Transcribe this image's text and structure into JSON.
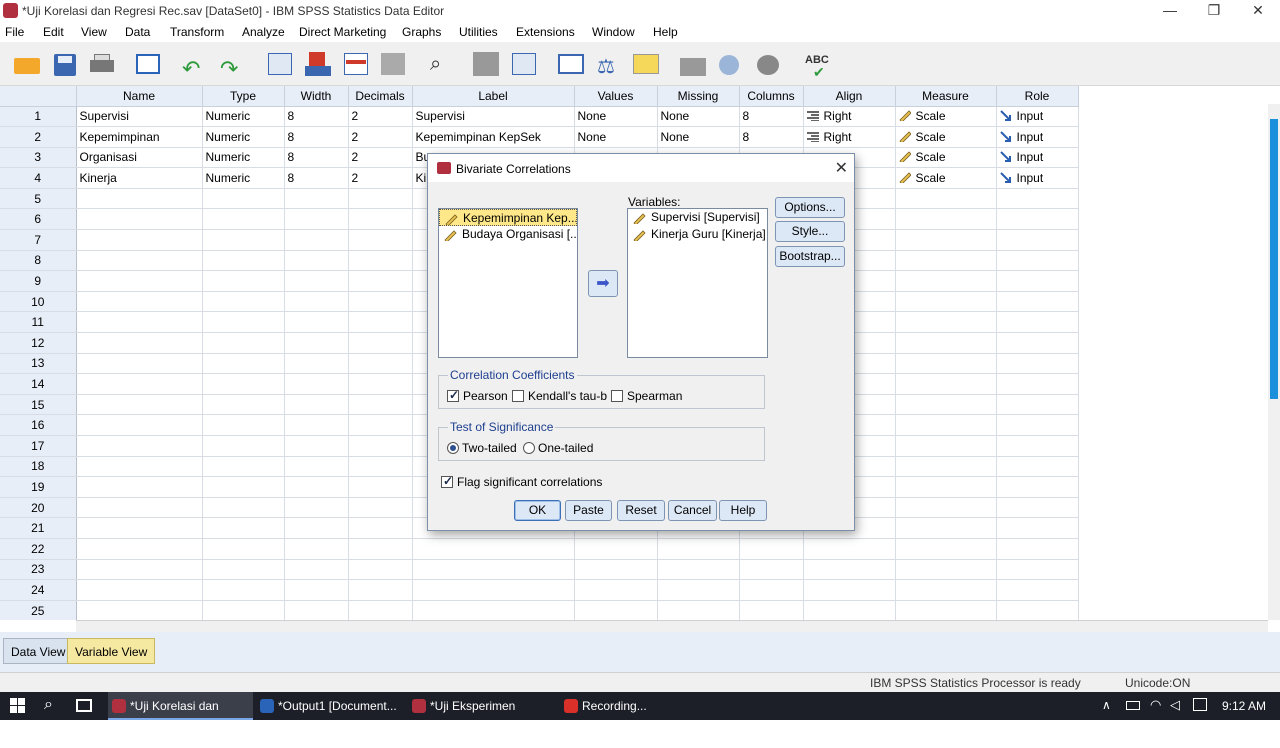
{
  "window": {
    "title": "*Uji Korelasi dan Regresi Rec.sav [DataSet0] - IBM SPSS Statistics Data Editor"
  },
  "menu": [
    "File",
    "Edit",
    "View",
    "Data",
    "Transform",
    "Analyze",
    "Direct Marketing",
    "Graphs",
    "Utilities",
    "Extensions",
    "Window",
    "Help"
  ],
  "toolbar_icons": [
    "open-folder-icon",
    "save-icon",
    "print-icon",
    "dialog-recall-icon",
    "undo-icon",
    "redo-icon",
    "goto-case-icon",
    "goto-variable-icon",
    "variables-icon",
    "run-descriptives-icon",
    "find-icon",
    "insert-cases-icon",
    "insert-variable-icon",
    "split-file-icon",
    "weight-cases-icon",
    "select-cases-icon",
    "value-labels-icon",
    "use-sets-icon",
    "show-all-variables-icon",
    "spell-check-icon"
  ],
  "grid": {
    "columns": [
      "Name",
      "Type",
      "Width",
      "Decimals",
      "Label",
      "Values",
      "Missing",
      "Columns",
      "Align",
      "Measure",
      "Role"
    ],
    "rows": [
      {
        "n": "1",
        "name": "Supervisi",
        "type": "Numeric",
        "width": "8",
        "decimals": "2",
        "label": "Supervisi",
        "values": "None",
        "missing": "None",
        "columns": "8",
        "align": "Right",
        "measure": "Scale",
        "role": "Input"
      },
      {
        "n": "2",
        "name": "Kepemimpinan",
        "type": "Numeric",
        "width": "8",
        "decimals": "2",
        "label": "Kepemimpinan KepSek",
        "values": "None",
        "missing": "None",
        "columns": "8",
        "align": "Right",
        "measure": "Scale",
        "role": "Input"
      },
      {
        "n": "3",
        "name": "Organisasi",
        "type": "Numeric",
        "width": "8",
        "decimals": "2",
        "label": "Bu",
        "values": "",
        "missing": "",
        "columns": "",
        "align": "",
        "measure": "Scale",
        "role": "Input"
      },
      {
        "n": "4",
        "name": "Kinerja",
        "type": "Numeric",
        "width": "8",
        "decimals": "2",
        "label": "Ki",
        "values": "",
        "missing": "",
        "columns": "",
        "align": "",
        "measure": "Scale",
        "role": "Input"
      }
    ],
    "empty_rows": [
      "5",
      "6",
      "7",
      "8",
      "9",
      "10",
      "11",
      "12",
      "13",
      "14",
      "15",
      "16",
      "17",
      "18",
      "19",
      "20",
      "21",
      "22",
      "23",
      "24",
      "25"
    ]
  },
  "tabs": {
    "data_view": "Data View",
    "variable_view": "Variable View"
  },
  "status": {
    "processor": "IBM SPSS Statistics Processor is ready",
    "unicode": "Unicode:ON"
  },
  "taskbar": {
    "items": [
      "*Uji Korelasi dan Regr...",
      "*Output1 [Document...",
      "*Uji Eksperimen Rec.s...",
      "Recording..."
    ],
    "clock": "9:12 AM"
  },
  "dialog": {
    "title": "Bivariate Correlations",
    "source_items": [
      "Kepemimpinan Kep...",
      "Budaya Organisasi [..."
    ],
    "variables_label": "Variables:",
    "target_items": [
      "Supervisi [Supervisi]",
      "Kinerja Guru [Kinerja]"
    ],
    "side_buttons": [
      "Options...",
      "Style...",
      "Bootstrap..."
    ],
    "coefficients": {
      "legend": "Correlation Coefficients",
      "pearson": "Pearson",
      "pearson_checked": true,
      "kendall": "Kendall's tau-b",
      "kendall_checked": false,
      "spearman": "Spearman",
      "spearman_checked": false
    },
    "significance": {
      "legend": "Test of Significance",
      "two_tailed": "Two-tailed",
      "one_tailed": "One-tailed",
      "selected": "Two-tailed"
    },
    "flag": {
      "label": "Flag significant correlations",
      "checked": true
    },
    "bottom_buttons": [
      "OK",
      "Paste",
      "Reset",
      "Cancel",
      "Help"
    ]
  }
}
